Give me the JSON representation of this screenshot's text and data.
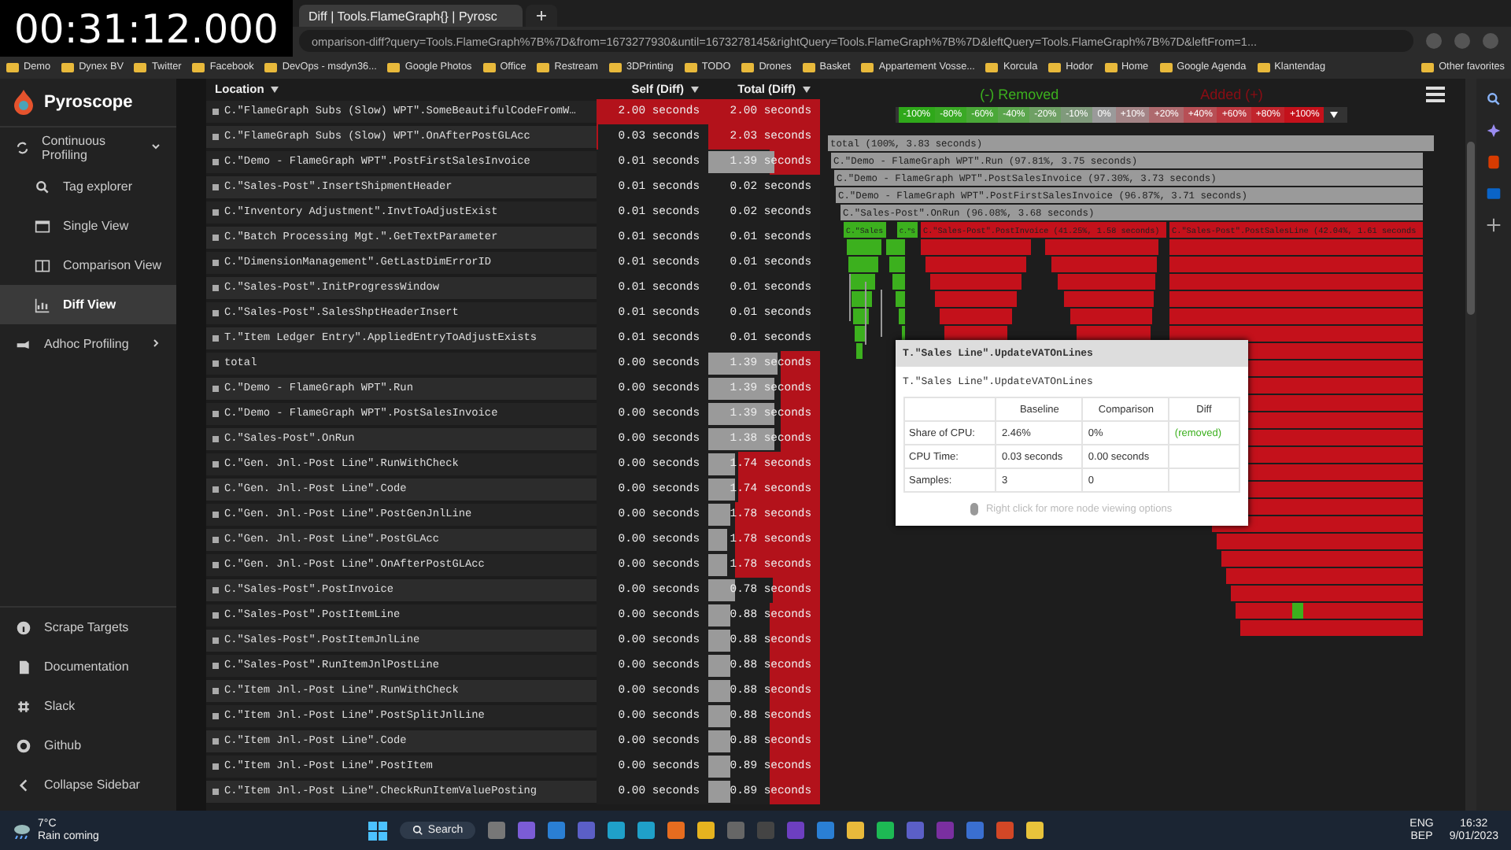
{
  "overlay": {
    "timer": "00:31:12.000"
  },
  "browser": {
    "tabs": [
      {
        "title": "Diff | Tools.FlameGraph{} | Pyrosc",
        "selected": true
      }
    ],
    "address": "omparison-diff?query=Tools.FlameGraph%7B%7D&from=1673277930&until=1673278145&rightQuery=Tools.FlameGraph%7B%7D&leftQuery=Tools.FlameGraph%7B%7D&leftFrom=1...",
    "bookmarks": [
      "Demo",
      "Dynex BV",
      "Twitter",
      "Facebook",
      "DevOps - msdyn36...",
      "Google Photos",
      "Office",
      "Restream",
      "3DPrinting",
      "TODO",
      "Drones",
      "Basket",
      "Appartement Vosse...",
      "Korcula",
      "Hodor",
      "Home",
      "Google Agenda",
      "Klantendag"
    ],
    "other_favorites": "Other favorites"
  },
  "sidebar": {
    "brand": "Pyroscope",
    "items": [
      {
        "label": "Continuous Profiling",
        "expanded": true,
        "children": [
          {
            "label": "Tag explorer",
            "selected": false
          },
          {
            "label": "Single View",
            "selected": false
          },
          {
            "label": "Comparison View",
            "selected": false
          },
          {
            "label": "Diff View",
            "selected": true
          }
        ]
      },
      {
        "label": "Adhoc Profiling",
        "expanded": false
      }
    ],
    "bottom": [
      "Scrape Targets",
      "Documentation",
      "Slack",
      "Github",
      "Collapse Sidebar"
    ]
  },
  "table": {
    "columns": [
      "Location",
      "Self (Diff)",
      "Total (Diff)"
    ],
    "rows": [
      {
        "location": "C.\"FlameGraph Subs (Slow) WPT\".SomeBeautifulCodeFromW…",
        "self": {
          "text": "2.00 seconds",
          "level": 1
        },
        "total": {
          "text": "2.00 seconds",
          "level": 1
        }
      },
      {
        "location": "C.\"FlameGraph Subs (Slow) WPT\".OnAfterPostGLAcc",
        "self": {
          "text": "0.03 seconds",
          "level": 0.02
        },
        "total": {
          "text": "2.03 seconds",
          "level": 1
        }
      },
      {
        "location": "C.\"Demo - FlameGraph WPT\".PostFirstSalesInvoice",
        "self": {
          "text": "0.01 seconds"
        },
        "total": {
          "text": "1.39 seconds",
          "level": 0.45
        },
        "baseline": {
          "level": 0.6
        }
      },
      {
        "location": "C.\"Sales-Post\".InsertShipmentHeader",
        "self": {
          "text": "0.01 seconds"
        },
        "total": {
          "text": "0.02 seconds"
        }
      },
      {
        "location": "C.\"Inventory Adjustment\".InvtToAdjustExist",
        "self": {
          "text": "0.01 seconds"
        },
        "total": {
          "text": "0.02 seconds"
        }
      },
      {
        "location": "C.\"Batch Processing Mgt.\".GetTextParameter",
        "self": {
          "text": "0.01 seconds"
        },
        "total": {
          "text": "0.01 seconds"
        }
      },
      {
        "location": "C.\"DimensionManagement\".GetLastDimErrorID",
        "self": {
          "text": "0.01 seconds"
        },
        "total": {
          "text": "0.01 seconds"
        }
      },
      {
        "location": "C.\"Sales-Post\".InitProgressWindow",
        "self": {
          "text": "0.01 seconds"
        },
        "total": {
          "text": "0.01 seconds"
        }
      },
      {
        "location": "C.\"Sales-Post\".SalesShptHeaderInsert",
        "self": {
          "text": "0.01 seconds"
        },
        "total": {
          "text": "0.01 seconds"
        }
      },
      {
        "location": "T.\"Item Ledger Entry\".AppliedEntryToAdjustExists",
        "self": {
          "text": "0.01 seconds"
        },
        "total": {
          "text": "0.01 seconds"
        }
      },
      {
        "location": "total",
        "self": {
          "text": "0.00 seconds"
        },
        "total": {
          "text": "1.39 seconds",
          "level": 0.35
        },
        "baseline": {
          "level": 0.63
        }
      },
      {
        "location": "C.\"Demo - FlameGraph WPT\".Run",
        "self": {
          "text": "0.00 seconds"
        },
        "total": {
          "text": "1.39 seconds",
          "level": 0.35
        },
        "baseline": {
          "level": 0.6
        }
      },
      {
        "location": "C.\"Demo - FlameGraph WPT\".PostSalesInvoice",
        "self": {
          "text": "0.00 seconds"
        },
        "total": {
          "text": "1.39 seconds",
          "level": 0.35
        },
        "baseline": {
          "level": 0.6
        }
      },
      {
        "location": "C.\"Sales-Post\".OnRun",
        "self": {
          "text": "0.00 seconds"
        },
        "total": {
          "text": "1.38 seconds",
          "level": 0.35
        },
        "baseline": {
          "level": 0.6
        }
      },
      {
        "location": "C.\"Gen. Jnl.-Post Line\".RunWithCheck",
        "self": {
          "text": "0.00 seconds"
        },
        "total": {
          "text": "1.74 seconds",
          "level": 0.73
        },
        "baseline": {
          "level": 0.25
        }
      },
      {
        "location": "C.\"Gen. Jnl.-Post Line\".Code",
        "self": {
          "text": "0.00 seconds"
        },
        "total": {
          "text": "1.74 seconds",
          "level": 0.73
        },
        "baseline": {
          "level": 0.24
        }
      },
      {
        "location": "C.\"Gen. Jnl.-Post Line\".PostGenJnlLine",
        "self": {
          "text": "0.00 seconds"
        },
        "total": {
          "text": "1.78 seconds",
          "level": 0.76
        },
        "baseline": {
          "level": 0.2
        }
      },
      {
        "location": "C.\"Gen. Jnl.-Post Line\".PostGLAcc",
        "self": {
          "text": "0.00 seconds"
        },
        "total": {
          "text": "1.78 seconds",
          "level": 0.76
        },
        "baseline": {
          "level": 0.18
        }
      },
      {
        "location": "C.\"Gen. Jnl.-Post Line\".OnAfterPostGLAcc",
        "self": {
          "text": "0.00 seconds"
        },
        "total": {
          "text": "1.78 seconds",
          "level": 0.76
        },
        "baseline": {
          "level": 0.17
        }
      },
      {
        "location": "C.\"Sales-Post\".PostInvoice",
        "self": {
          "text": "0.00 seconds"
        },
        "total": {
          "text": "0.78 seconds",
          "level": 0.41
        },
        "baseline": {
          "level": 0.24
        }
      },
      {
        "location": "C.\"Sales-Post\".PostItemLine",
        "self": {
          "text": "0.00 seconds"
        },
        "total": {
          "text": "0.88 seconds",
          "level": 0.45
        },
        "baseline": {
          "level": 0.21
        }
      },
      {
        "location": "C.\"Sales-Post\".PostItemJnlLine",
        "self": {
          "text": "0.00 seconds"
        },
        "total": {
          "text": "0.88 seconds",
          "level": 0.45
        },
        "baseline": {
          "level": 0.21
        }
      },
      {
        "location": "C.\"Sales-Post\".RunItemJnlPostLine",
        "self": {
          "text": "0.00 seconds"
        },
        "total": {
          "text": "0.88 seconds",
          "level": 0.45
        },
        "baseline": {
          "level": 0.21
        }
      },
      {
        "location": "C.\"Item Jnl.-Post Line\".RunWithCheck",
        "self": {
          "text": "0.00 seconds"
        },
        "total": {
          "text": "0.88 seconds",
          "level": 0.45
        },
        "baseline": {
          "level": 0.21
        }
      },
      {
        "location": "C.\"Item Jnl.-Post Line\".PostSplitJnlLine",
        "self": {
          "text": "0.00 seconds"
        },
        "total": {
          "text": "0.88 seconds",
          "level": 0.45
        },
        "baseline": {
          "level": 0.2
        }
      },
      {
        "location": "C.\"Item Jnl.-Post Line\".Code",
        "self": {
          "text": "0.00 seconds"
        },
        "total": {
          "text": "0.88 seconds",
          "level": 0.45
        },
        "baseline": {
          "level": 0.2
        }
      },
      {
        "location": "C.\"Item Jnl.-Post Line\".PostItem",
        "self": {
          "text": "0.00 seconds"
        },
        "total": {
          "text": "0.89 seconds",
          "level": 0.45
        },
        "baseline": {
          "level": 0.2
        }
      },
      {
        "location": "C.\"Item Jnl.-Post Line\".CheckRunItemValuePosting",
        "self": {
          "text": "0.00 seconds"
        },
        "total": {
          "text": "0.89 seconds",
          "level": 0.45
        },
        "baseline": {
          "level": 0.2
        }
      }
    ]
  },
  "flamegraph": {
    "removed_label": "(-) Removed",
    "added_label": "Added (+)",
    "scale": [
      {
        "label": "-100%",
        "color": "#2fa81a"
      },
      {
        "label": "-80%",
        "color": "#3aa925"
      },
      {
        "label": "-60%",
        "color": "#4aa838"
      },
      {
        "label": "-40%",
        "color": "#5ba54d"
      },
      {
        "label": "-20%",
        "color": "#6fa065"
      },
      {
        "label": "-10%",
        "color": "#809a7c"
      },
      {
        "label": "0%",
        "color": "#9a9a9a"
      },
      {
        "label": "+10%",
        "color": "#a38486"
      },
      {
        "label": "+20%",
        "color": "#ae6a6e"
      },
      {
        "label": "+40%",
        "color": "#b74f55"
      },
      {
        "label": "+60%",
        "color": "#bd3840"
      },
      {
        "label": "+80%",
        "color": "#c1242c"
      },
      {
        "label": "+100%",
        "color": "#c4111b"
      }
    ],
    "frames": [
      {
        "label": "total (100%, 3.83 seconds)",
        "color": "#9a9a9a"
      },
      {
        "label": "C.\"Demo - FlameGraph WPT\".Run (97.81%, 3.75 seconds)",
        "color": "#9a9a9a"
      },
      {
        "label": "C.\"Demo - FlameGraph WPT\".PostSalesInvoice (97.30%, 3.73 seconds)",
        "color": "#9a9a9a"
      },
      {
        "label": "C.\"Demo - FlameGraph WPT\".PostFirstSalesInvoice (96.87%, 3.71 seconds)",
        "color": "#9a9a9a"
      },
      {
        "label": "C.\"Sales-Post\".OnRun (96.08%, 3.68 seconds)",
        "color": "#9a9a9a"
      },
      {
        "label": "C.\"Sales",
        "color": "#3cb01e"
      },
      {
        "label": "C.\"S",
        "color": "#3cb01e"
      },
      {
        "label": "C.\"Sales-Post\".PostInvoice (41.25%, 1.58 seconds)",
        "color": "#c4111b"
      },
      {
        "label": "C.\"Sales-Post\".PostSalesLine (42.04%, 1.61 seconds",
        "color": "#c4111b"
      }
    ],
    "tooltip": {
      "title": "T.\"Sales Line\".UpdateVATOnLines",
      "subtitle": "T.\"Sales Line\".UpdateVATOnLines",
      "columns": [
        "Baseline",
        "Comparison",
        "Diff"
      ],
      "rows": [
        {
          "label": "Share of CPU:",
          "baseline": "2.46%",
          "comparison": "0%",
          "diff": "(removed)"
        },
        {
          "label": "CPU Time:",
          "baseline": "0.03 seconds",
          "comparison": "0.00 seconds"
        },
        {
          "label": "Samples:",
          "baseline": "3",
          "comparison": "0"
        }
      ],
      "hint": "Right click for more node viewing options"
    }
  },
  "taskbar": {
    "temperature": "7°C",
    "weather": "Rain coming",
    "search": "Search",
    "language": "ENG",
    "layout": "BEP",
    "time": "16:32",
    "date": "9/01/2023"
  }
}
